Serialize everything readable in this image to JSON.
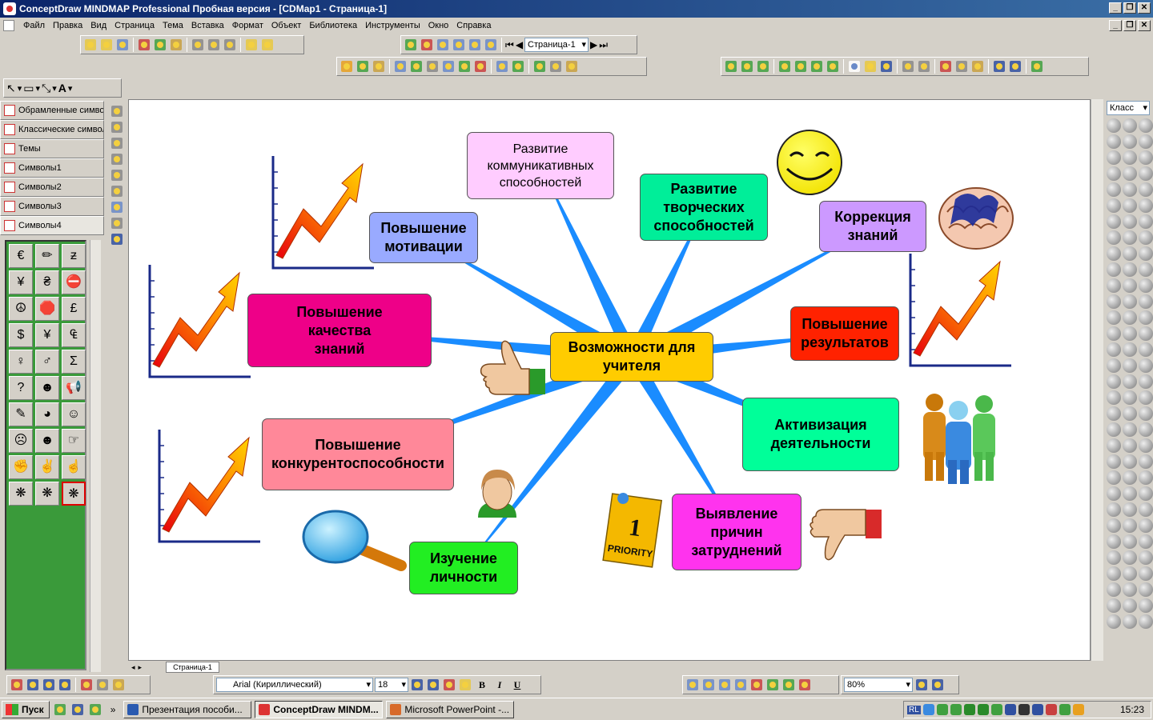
{
  "window": {
    "title": "ConceptDraw MINDMAP Professional Пробная версия - [CDMap1 - Страница-1]"
  },
  "menu": [
    "Файл",
    "Правка",
    "Вид",
    "Страница",
    "Тема",
    "Вставка",
    "Формат",
    "Объект",
    "Библиотека",
    "Инструменты",
    "Окно",
    "Справка"
  ],
  "toolbar": {
    "page_select": "Страница-1"
  },
  "libraries": [
    "Обрамленные символы",
    "Классические символы",
    "Темы",
    "Символы1",
    "Символы2",
    "Символы3",
    "Символы4"
  ],
  "palette_icons": [
    "euro-icon",
    "dollar-swirl-icon",
    "yen-symbol-icon",
    "yen-icon",
    "hryvnia-icon",
    "no-entry-icon",
    "peace-icon",
    "stop-sign-icon",
    "pound-icon",
    "dollar-icon",
    "yuan-icon",
    "ecu-icon",
    "female-icon",
    "male-icon",
    "sigma-icon",
    "question-head-icon",
    "person-icon",
    "megaphone-icon",
    "map-icon",
    "pacman-icon",
    "smiley-icon",
    "sad-face-icon",
    "happy-face-icon",
    "pointing-hand-icon",
    "fist-icon",
    "hand-ok-icon",
    "hand-point-icon",
    "brain-icon",
    "brain2-icon",
    "brain3-icon"
  ],
  "map": {
    "central": "Возможности для\nучителя",
    "topics": [
      {
        "key": "t1",
        "label": "Развитие\nкоммуникативных\nспособностей",
        "color": "#ffccff"
      },
      {
        "key": "t2",
        "label": "Развитие\nтворческих\nспособностей",
        "color": "#00ee99"
      },
      {
        "key": "t3",
        "label": "Коррекция\nзнаний",
        "color": "#cc99ff"
      },
      {
        "key": "t4",
        "label": "Повышение\nмотивации",
        "color": "#99aaff"
      },
      {
        "key": "t5",
        "label": "Повышение\nкачества\nзнаний",
        "color": "#ee0088"
      },
      {
        "key": "t6",
        "label": "Повышение\nрезультатов",
        "color": "#ff2200"
      },
      {
        "key": "t7",
        "label": "Активизация\nдеятельности",
        "color": "#00ff99"
      },
      {
        "key": "t8",
        "label": "Повышение\nконкурентоспособности",
        "color": "#ff8899"
      },
      {
        "key": "t9",
        "label": "Выявление\nпричин\nзатруднений",
        "color": "#ff33ee"
      },
      {
        "key": "t10",
        "label": "Изучение\nличности",
        "color": "#22ee22"
      }
    ],
    "central_color": "#ffcc00",
    "link_color": "#1a8cff"
  },
  "clipart": {
    "priority_label": "PRIORITY",
    "priority_number": "1"
  },
  "page_tab": "Страница-1",
  "symbols_panel": {
    "class_select": "Класс"
  },
  "format": {
    "font": "Arial (Кириллический)",
    "size": "18",
    "bold": "B",
    "italic": "I",
    "underline": "U",
    "zoom": "80%"
  },
  "taskbar": {
    "start": "Пуск",
    "tasks": [
      "Презентация пособи...",
      "ConceptDraw MINDM...",
      "Microsoft PowerPoint -..."
    ],
    "lang": "RL",
    "clock": "15:23"
  }
}
